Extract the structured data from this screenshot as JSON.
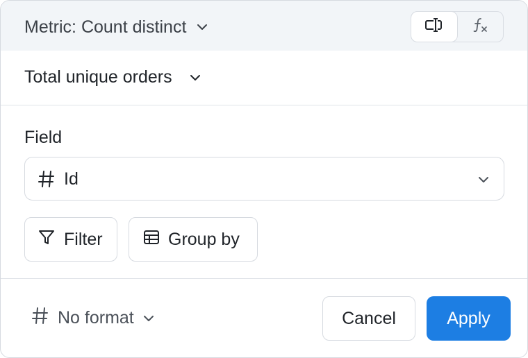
{
  "header": {
    "metric_label": "Metric: Count distinct",
    "modes": [
      {
        "icon": "field-mode-icon",
        "active": true
      },
      {
        "icon": "formula-fx-icon",
        "active": false
      }
    ]
  },
  "metric_name": {
    "value": "Total unique orders"
  },
  "field": {
    "label": "Field",
    "type_icon": "hash-icon",
    "value": "Id"
  },
  "actions": {
    "filter_label": "Filter",
    "group_by_label": "Group by"
  },
  "footer": {
    "format_label": "No format",
    "cancel_label": "Cancel",
    "apply_label": "Apply"
  },
  "colors": {
    "accent": "#1d7ee3",
    "header_bg": "#f2f5f8",
    "border": "#d6dae0"
  }
}
